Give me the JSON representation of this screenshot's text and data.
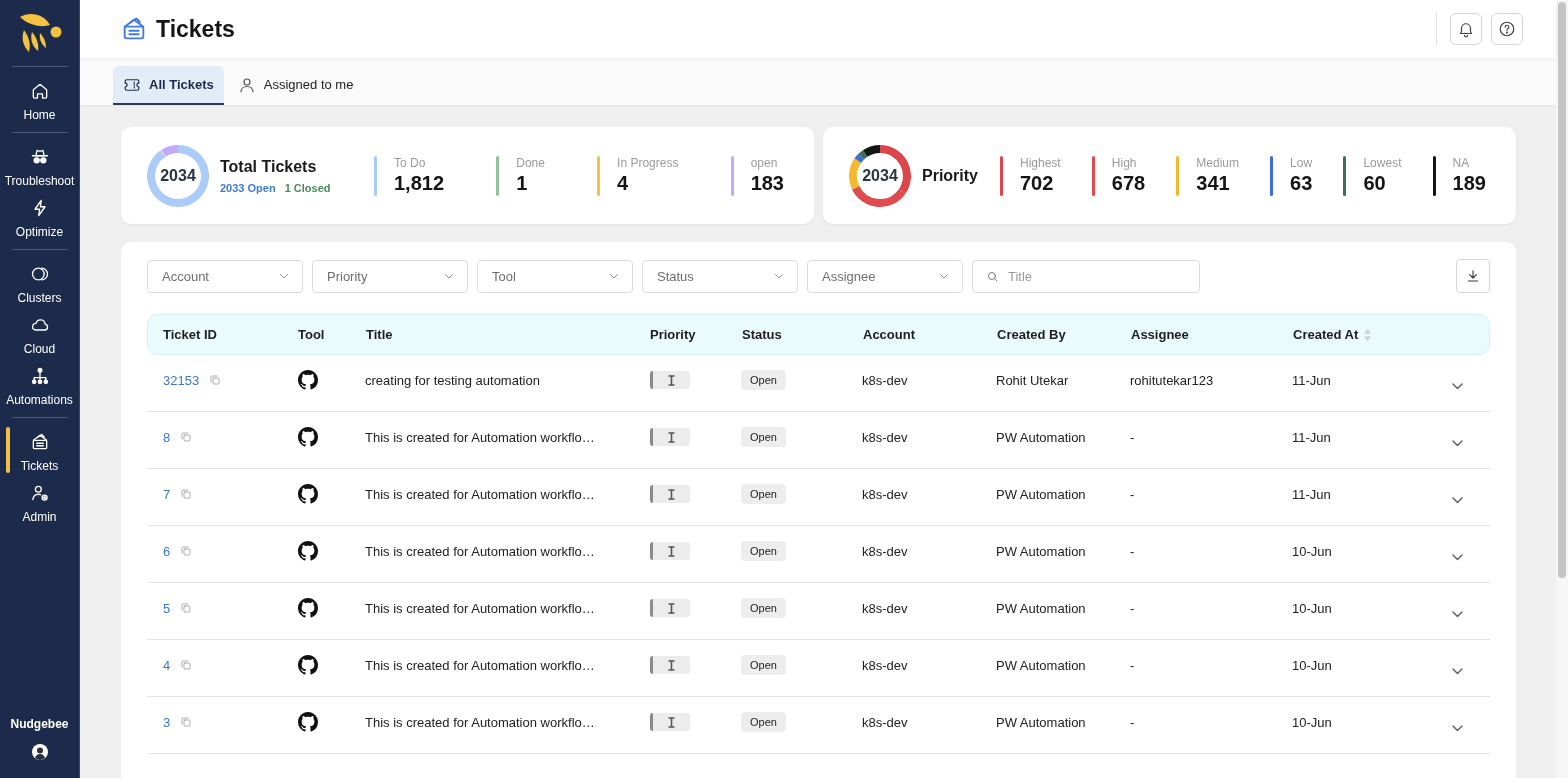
{
  "sidebar": {
    "groups": [
      {
        "items": [
          {
            "label": "Home",
            "selected": false
          }
        ]
      },
      {
        "items": [
          {
            "label": "Troubleshoot",
            "selected": false
          },
          {
            "label": "Optimize",
            "selected": false
          }
        ]
      },
      {
        "items": [
          {
            "label": "Clusters",
            "selected": false
          },
          {
            "label": "Cloud",
            "selected": false
          },
          {
            "label": "Automations",
            "selected": false
          }
        ]
      },
      {
        "items": [
          {
            "label": "Tickets",
            "selected": true
          },
          {
            "label": "Admin",
            "selected": false
          }
        ]
      }
    ],
    "org_name": "Nudgebee"
  },
  "header": {
    "title": "Tickets"
  },
  "tabs": [
    {
      "label": "All Tickets",
      "selected": true
    },
    {
      "label": "Assigned to me",
      "selected": false
    }
  ],
  "summary_cards": [
    {
      "title": "Total Tickets",
      "total": "2034",
      "subtitles": [
        {
          "text": "2033 Open",
          "color": "#3b7dd8"
        },
        {
          "text": "1 Closed",
          "color": "#4b8b5b"
        }
      ],
      "stats": [
        {
          "label": "To Do",
          "value": "1,812",
          "color": "#abcbf8"
        },
        {
          "label": "Done",
          "value": "1",
          "color": "#8fc49c"
        },
        {
          "label": "In Progress",
          "value": "4",
          "color": "#f2c24f"
        },
        {
          "label": "open",
          "value": "183",
          "color": "#c3aaf5"
        }
      ]
    },
    {
      "title": "Priority",
      "total": "2034",
      "stats": [
        {
          "label": "Highest",
          "value": "702",
          "color": "#dc464b"
        },
        {
          "label": "High",
          "value": "678",
          "color": "#e14a4e"
        },
        {
          "label": "Medium",
          "value": "341",
          "color": "#f4b92f"
        },
        {
          "label": "Low",
          "value": "63",
          "color": "#3e6fd6"
        },
        {
          "label": "Lowest",
          "value": "60",
          "color": "#3f6e52"
        },
        {
          "label": "NA",
          "value": "189",
          "color": "#141414"
        }
      ]
    }
  ],
  "filters": {
    "dropdowns": [
      {
        "placeholder": "Account"
      },
      {
        "placeholder": "Priority"
      },
      {
        "placeholder": "Tool"
      },
      {
        "placeholder": "Status"
      },
      {
        "placeholder": "Assignee"
      }
    ],
    "search": {
      "placeholder": "Title"
    }
  },
  "table": {
    "columns": [
      {
        "label": "Ticket ID",
        "sortable": false
      },
      {
        "label": "Tool",
        "sortable": false
      },
      {
        "label": "Title",
        "sortable": false
      },
      {
        "label": "Priority",
        "sortable": false
      },
      {
        "label": "Status",
        "sortable": false
      },
      {
        "label": "Account",
        "sortable": false
      },
      {
        "label": "Created By",
        "sortable": false
      },
      {
        "label": "Assignee",
        "sortable": false
      },
      {
        "label": "Created At",
        "sortable": true
      }
    ],
    "rows": [
      {
        "ticket_id": "32153",
        "title": "creating for testing automation",
        "status": "Open",
        "account": "k8s-dev",
        "created_by": "Rohit Utekar",
        "assignee": "rohitutekar123",
        "created_at": "11-Jun",
        "expanded": false
      },
      {
        "ticket_id": "8",
        "title": "This is created for Automation workflo…",
        "status": "Open",
        "account": "k8s-dev",
        "created_by": "PW Automation",
        "assignee": "-",
        "created_at": "11-Jun",
        "expanded": false
      },
      {
        "ticket_id": "7",
        "title": "This is created for Automation workflo…",
        "status": "Open",
        "account": "k8s-dev",
        "created_by": "PW Automation",
        "assignee": "-",
        "created_at": "11-Jun",
        "expanded": false
      },
      {
        "ticket_id": "6",
        "title": "This is created for Automation workflo…",
        "status": "Open",
        "account": "k8s-dev",
        "created_by": "PW Automation",
        "assignee": "-",
        "created_at": "10-Jun",
        "expanded": false
      },
      {
        "ticket_id": "5",
        "title": "This is created for Automation workflo…",
        "status": "Open",
        "account": "k8s-dev",
        "created_by": "PW Automation",
        "assignee": "-",
        "created_at": "10-Jun",
        "expanded": false
      },
      {
        "ticket_id": "4",
        "title": "This is created for Automation workflo…",
        "status": "Open",
        "account": "k8s-dev",
        "created_by": "PW Automation",
        "assignee": "-",
        "created_at": "10-Jun",
        "expanded": false
      },
      {
        "ticket_id": "3",
        "title": "This is created for Automation workflo…",
        "status": "Open",
        "account": "k8s-dev",
        "created_by": "PW Automation",
        "assignee": "-",
        "created_at": "10-Jun",
        "expanded": false
      }
    ]
  }
}
